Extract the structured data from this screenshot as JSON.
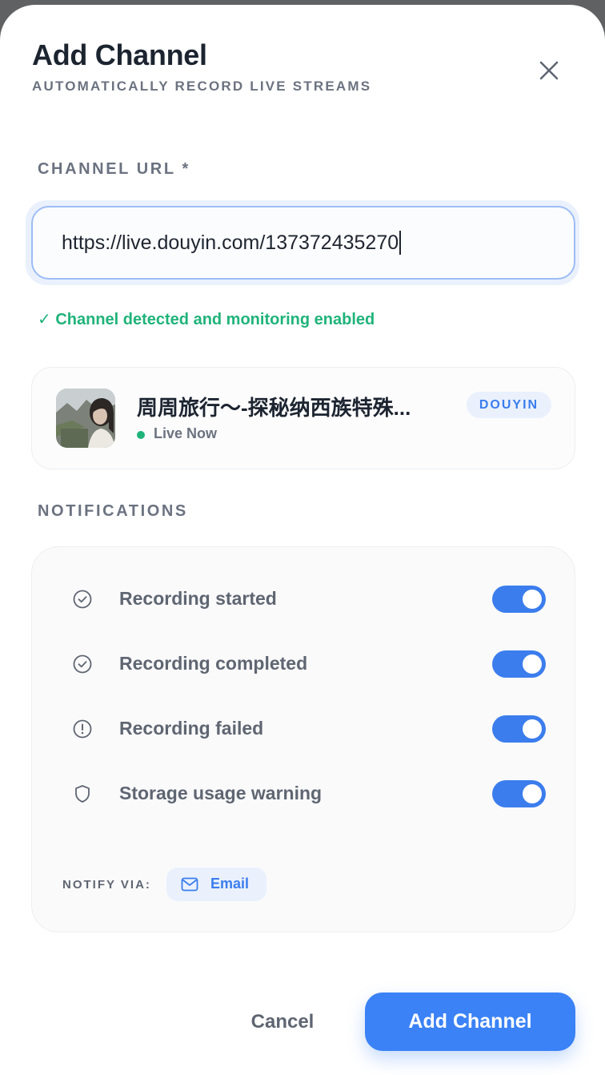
{
  "dialog": {
    "title": "Add Channel",
    "subtitle": "AUTOMATICALLY RECORD LIVE STREAMS",
    "close_icon": "close-icon"
  },
  "url_field": {
    "label": "CHANNEL URL *",
    "value": "https://live.douyin.com/137372435270",
    "status": "✓ Channel detected and monitoring enabled",
    "status_color": "#1fb37a"
  },
  "channel": {
    "name": "周周旅行～-探秘纳西族特殊...",
    "status": "Live Now",
    "platform": "DOUYIN",
    "live_color": "#1fb37a"
  },
  "notifications": {
    "label": "NOTIFICATIONS",
    "items": [
      {
        "label": "Recording started",
        "icon": "check-circle-icon",
        "enabled": true
      },
      {
        "label": "Recording completed",
        "icon": "check-circle-icon",
        "enabled": true
      },
      {
        "label": "Recording failed",
        "icon": "alert-circle-icon",
        "enabled": true
      },
      {
        "label": "Storage usage warning",
        "icon": "shield-icon",
        "enabled": true
      }
    ],
    "notify_via_label": "NOTIFY VIA:",
    "channel_label": "Email",
    "channel_icon": "mail-icon"
  },
  "actions": {
    "cancel": "Cancel",
    "submit": "Add Channel"
  },
  "colors": {
    "accent": "#3b82f6",
    "success": "#1fb37a"
  }
}
